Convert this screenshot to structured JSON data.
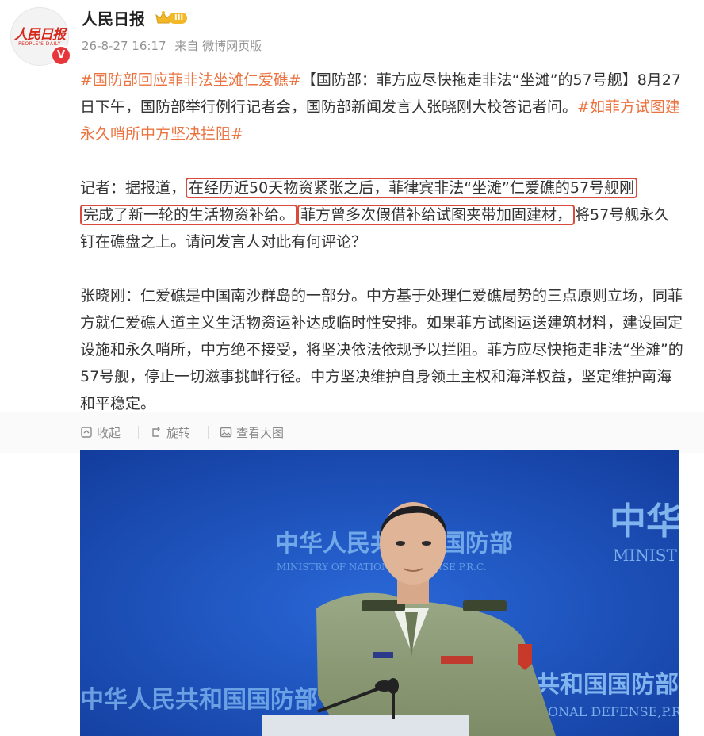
{
  "account": {
    "logo_text": "人民日报",
    "logo_subtext": "PEOPLE'S DAILY",
    "verified_glyph": "V",
    "name": "人民日报",
    "vip_level": "III",
    "timestamp": "26-8-27 16:17",
    "source": "来自 微博网页版"
  },
  "post": {
    "hashtag1": "#国防部回应菲非法坐滩仁爱礁#",
    "intro": "【国防部：菲方应尽快拖走非法“坐滩”的57号舰】8月27日下午，国防部举行例行记者会，国防部新闻发言人张晓刚大校答记者问。",
    "hashtag2": "#如菲方试图建永久哨所中方坚决拦阻#",
    "q_prefix": "记者：据报道，",
    "q_box1_line1": "在经历近50天物资紧张之后，菲律宾非法“坐滩”仁爱礁的57号舰刚",
    "q_box1_line2": "完成了新一轮的生活物资补给。",
    "q_box2": "菲方曾多次假借补给试图夹带加固建材，",
    "q_suffix": "将57号舰永久钉在礁盘之上。请问发言人对此有何评论？",
    "answer": "张晓刚：仁爱礁是中国南沙群岛的一部分。中方基于处理仁爱礁局势的三点原则立场，同菲方就仁爱礁人道主义生活物资运补达成临时性安排。如果菲方试图运送建筑材料，建设固定设施和永久哨所，中方绝不接受，将坚决依法依规予以拦阻。菲方应尽快拖走非法“坐滩”的57号舰，停止一切滋事挑衅行径。中方坚决维护自身领土主权和海洋权益，坚定维护南海和平稳定。"
  },
  "toolbar": {
    "collapse": "收起",
    "rotate": "旋转",
    "view_large": "查看大图"
  },
  "photo": {
    "backdrop_cn": "中华人民共和国国防部",
    "backdrop_en": "MINISTRY OF NATIONAL DEFENSE P.R.C.",
    "backdrop_right_cn": "中华",
    "backdrop_right_en": "MINIST",
    "bottom_cn": "中华人民共和国国防部",
    "bottom_right_cn": "共和国国防部",
    "bottom_right_en": "ONAL DEFENSE,P.R.",
    "colors": {
      "backdrop": "#1749b8",
      "uniform": "#8c9c74",
      "text": "#7fb6f0"
    }
  }
}
